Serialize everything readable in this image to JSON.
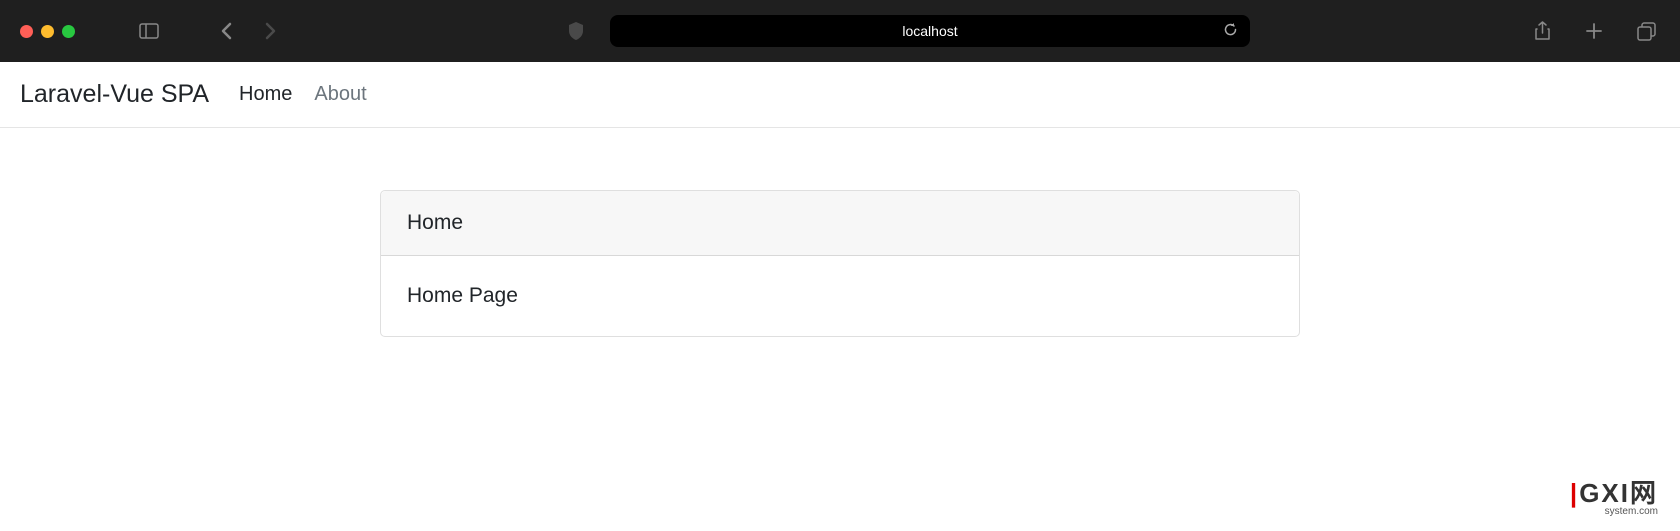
{
  "browser": {
    "url": "localhost"
  },
  "navbar": {
    "brand": "Laravel-Vue SPA",
    "links": [
      {
        "label": "Home",
        "active": true
      },
      {
        "label": "About",
        "active": false
      }
    ]
  },
  "card": {
    "header": "Home",
    "body": "Home Page"
  },
  "watermark": {
    "main": "GXI网",
    "sub": "system.com"
  }
}
